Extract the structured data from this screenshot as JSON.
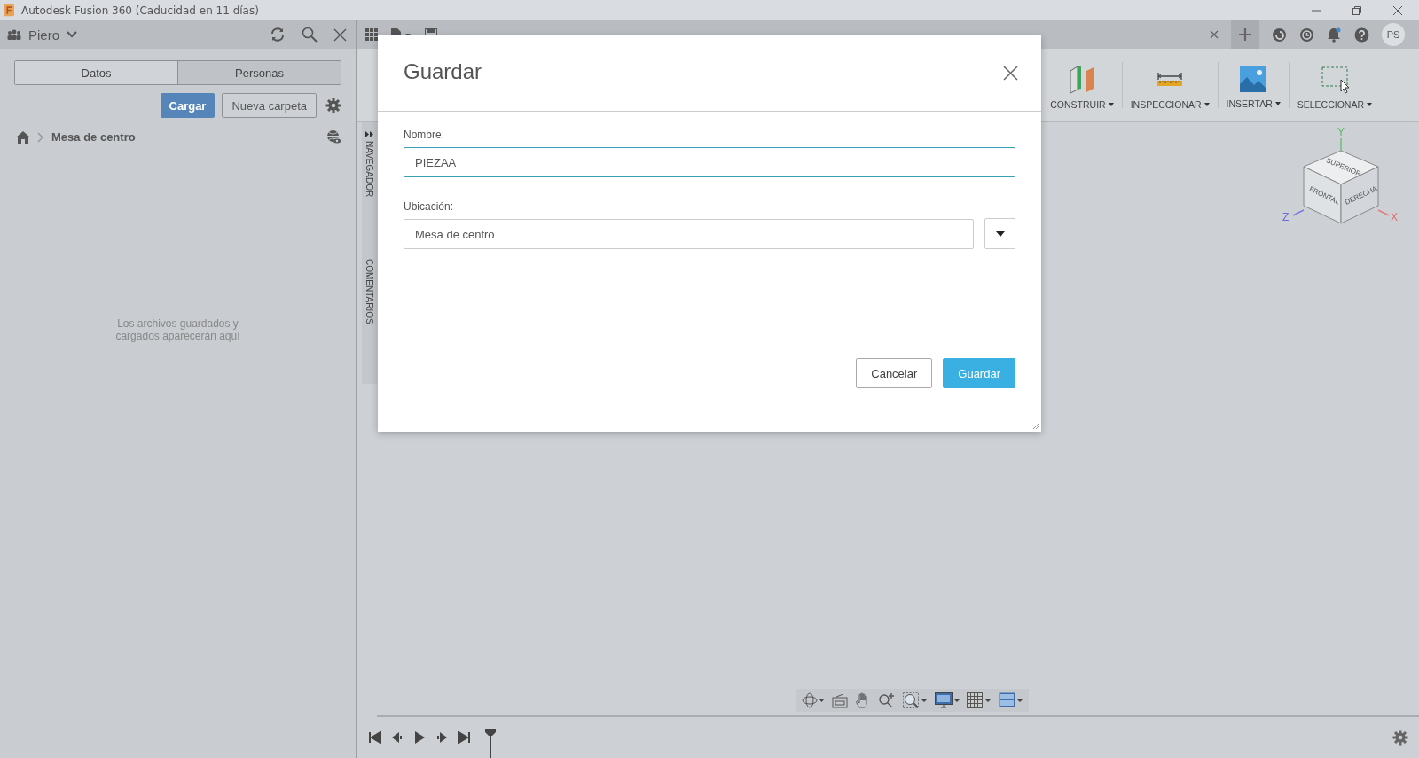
{
  "window": {
    "title": "Autodesk Fusion 360 (Caducidad en 11 días)"
  },
  "data_panel": {
    "user": "Piero",
    "tabs": [
      {
        "label": "Datos",
        "selected": true
      },
      {
        "label": "Personas",
        "selected": false
      }
    ],
    "upload_button": "Cargar",
    "new_folder_button": "Nueva carpeta",
    "breadcrumb": "Mesa de centro",
    "empty_message": "Los archivos guardados y cargados aparecerán aquí"
  },
  "top_bar": {
    "avatar": "PS"
  },
  "ribbon": {
    "groups": [
      {
        "label": "CONSTRUIR",
        "kind": "construct"
      },
      {
        "label": "INSPECCIONAR",
        "kind": "inspect"
      },
      {
        "label": "INSERTAR",
        "kind": "insert"
      },
      {
        "label": "SELECCIONAR",
        "kind": "select"
      }
    ]
  },
  "side_tabs": [
    "NAVEGADOR",
    "COMENTARIOS"
  ],
  "view_cube": {
    "faces": [
      "SUPERIOR",
      "FRONTAL",
      "DERECHA"
    ],
    "axes": [
      "Y",
      "Z",
      "X"
    ]
  },
  "dialog": {
    "title": "Guardar",
    "name_label": "Nombre:",
    "name_value": "PIEZAA",
    "location_label": "Ubicación:",
    "location_value": "Mesa de centro",
    "buttons": [
      {
        "label": "Cancelar",
        "kind": "secondary"
      },
      {
        "label": "Guardar",
        "kind": "primary"
      }
    ]
  }
}
